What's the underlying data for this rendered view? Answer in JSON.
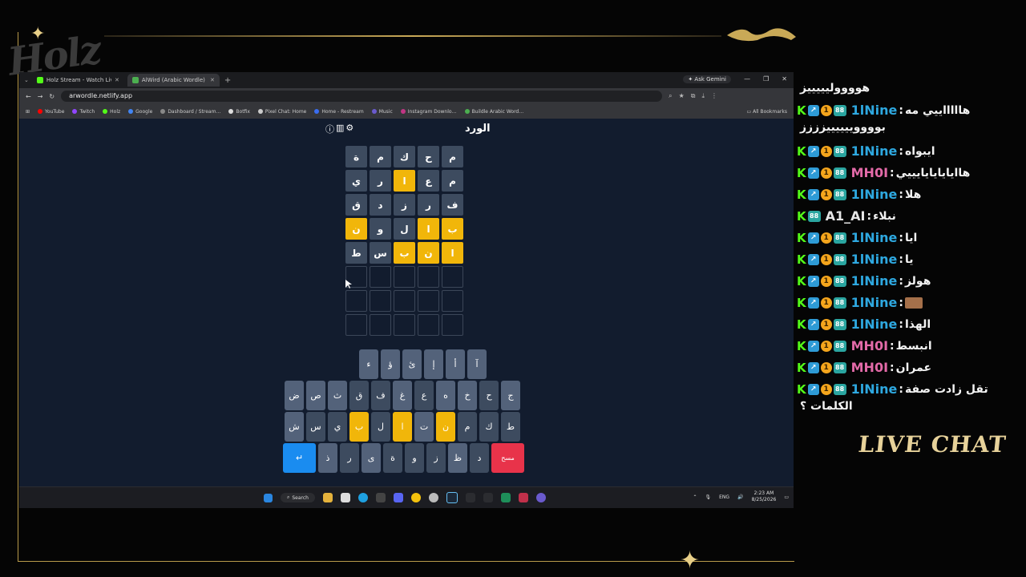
{
  "overlay": {
    "brand": "Holz",
    "live_chat_label": "LIVE CHAT"
  },
  "browser": {
    "tabs": [
      {
        "label": "Holz Stream - Watch Live on Ki…",
        "active": false
      },
      {
        "label": "AlWird (Arabic Wordle) - الورد",
        "active": true
      }
    ],
    "ask_gemini": "Ask Gemini",
    "url": "arwordle.netlify.app",
    "bookmarks": [
      "YouTube",
      "Twitch",
      "Holz",
      "Google",
      "Dashboard / Stream…",
      "Botfix",
      "Pixel Chat: Home",
      "Home - Restream",
      "Music",
      "Instagram Downlo…",
      "Buildle Arabic Word…"
    ],
    "all_bookmarks": "All Bookmarks"
  },
  "game": {
    "title": "الورد",
    "grid": [
      [
        {
          "l": "م",
          "s": "absent"
        },
        {
          "l": "ح",
          "s": "absent"
        },
        {
          "l": "ك",
          "s": "absent"
        },
        {
          "l": "م",
          "s": "absent"
        },
        {
          "l": "ة",
          "s": "absent"
        }
      ],
      [
        {
          "l": "م",
          "s": "absent"
        },
        {
          "l": "ع",
          "s": "absent"
        },
        {
          "l": "ا",
          "s": "present"
        },
        {
          "l": "ر",
          "s": "absent"
        },
        {
          "l": "ي",
          "s": "absent"
        }
      ],
      [
        {
          "l": "ف",
          "s": "absent"
        },
        {
          "l": "ر",
          "s": "absent"
        },
        {
          "l": "ز",
          "s": "absent"
        },
        {
          "l": "د",
          "s": "absent"
        },
        {
          "l": "ق",
          "s": "absent"
        }
      ],
      [
        {
          "l": "ب",
          "s": "present"
        },
        {
          "l": "ا",
          "s": "present"
        },
        {
          "l": "ل",
          "s": "absent"
        },
        {
          "l": "و",
          "s": "absent"
        },
        {
          "l": "ن",
          "s": "present"
        }
      ],
      [
        {
          "l": "ا",
          "s": "present"
        },
        {
          "l": "ن",
          "s": "present"
        },
        {
          "l": "ب",
          "s": "present"
        },
        {
          "l": "س",
          "s": "absent"
        },
        {
          "l": "ط",
          "s": "absent"
        }
      ],
      [
        {
          "l": "",
          "s": "empty"
        },
        {
          "l": "",
          "s": "empty"
        },
        {
          "l": "",
          "s": "empty"
        },
        {
          "l": "",
          "s": "empty"
        },
        {
          "l": "",
          "s": "empty"
        }
      ],
      [
        {
          "l": "",
          "s": "empty"
        },
        {
          "l": "",
          "s": "empty"
        },
        {
          "l": "",
          "s": "empty"
        },
        {
          "l": "",
          "s": "empty"
        },
        {
          "l": "",
          "s": "empty"
        }
      ],
      [
        {
          "l": "",
          "s": "empty"
        },
        {
          "l": "",
          "s": "empty"
        },
        {
          "l": "",
          "s": "empty"
        },
        {
          "l": "",
          "s": "empty"
        },
        {
          "l": "",
          "s": "empty"
        }
      ]
    ],
    "keyboard": [
      [
        {
          "k": "آ",
          "s": "light"
        },
        {
          "k": "أ",
          "s": "light"
        },
        {
          "k": "إ",
          "s": "light"
        },
        {
          "k": "ئ",
          "s": "light"
        },
        {
          "k": "ؤ",
          "s": "light"
        },
        {
          "k": "ء",
          "s": "light"
        }
      ],
      [
        {
          "k": "ج",
          "s": "light"
        },
        {
          "k": "ح",
          "s": "absent"
        },
        {
          "k": "خ",
          "s": "light"
        },
        {
          "k": "ه",
          "s": "light"
        },
        {
          "k": "ع",
          "s": "absent"
        },
        {
          "k": "غ",
          "s": "light"
        },
        {
          "k": "ف",
          "s": "absent"
        },
        {
          "k": "ق",
          "s": "absent"
        },
        {
          "k": "ث",
          "s": "light"
        },
        {
          "k": "ص",
          "s": "light"
        },
        {
          "k": "ض",
          "s": "light"
        }
      ],
      [
        {
          "k": "ط",
          "s": "absent"
        },
        {
          "k": "ك",
          "s": "absent"
        },
        {
          "k": "م",
          "s": "absent"
        },
        {
          "k": "ن",
          "s": "present"
        },
        {
          "k": "ت",
          "s": "light"
        },
        {
          "k": "ا",
          "s": "present"
        },
        {
          "k": "ل",
          "s": "absent"
        },
        {
          "k": "ب",
          "s": "present"
        },
        {
          "k": "ي",
          "s": "absent"
        },
        {
          "k": "س",
          "s": "absent"
        },
        {
          "k": "ش",
          "s": "light"
        }
      ],
      [
        {
          "k": "مسح",
          "s": "del"
        },
        {
          "k": "د",
          "s": "absent"
        },
        {
          "k": "ظ",
          "s": "light"
        },
        {
          "k": "ز",
          "s": "absent"
        },
        {
          "k": "و",
          "s": "absent"
        },
        {
          "k": "ة",
          "s": "absent"
        },
        {
          "k": "ى",
          "s": "light"
        },
        {
          "k": "ر",
          "s": "absent"
        },
        {
          "k": "ذ",
          "s": "light"
        },
        {
          "k": "↵",
          "s": "enter"
        }
      ]
    ]
  },
  "taskbar": {
    "search": "Search",
    "lang": "ENG",
    "time": "2:23 AM",
    "date": "8/25/2026"
  },
  "chat": {
    "messages": [
      {
        "user": "1lNine",
        "color": "#2ea8e0",
        "text": "هووووليييييز",
        "badges": 3,
        "wrap_only": true
      },
      {
        "user": "1lNine",
        "color": "#2ea8e0",
        "text": "هاااااييي مه",
        "cont": "بووووييييييزززز",
        "badges": 3
      },
      {
        "user": "1lNine",
        "color": "#2ea8e0",
        "text": "ايبواه",
        "badges": 3
      },
      {
        "user": "MH0I",
        "color": "#e36aa8",
        "text": "هاايايايايايييي",
        "badges": 3
      },
      {
        "user": "1lNine",
        "color": "#2ea8e0",
        "text": "هلا",
        "badges": 3
      },
      {
        "user": "A1_AI",
        "color": "#e6e6e6",
        "text": "نبلاء",
        "badges": 1
      },
      {
        "user": "1lNine",
        "color": "#2ea8e0",
        "text": "ايا",
        "badges": 3
      },
      {
        "user": "1lNine",
        "color": "#2ea8e0",
        "text": "يا",
        "badges": 3
      },
      {
        "user": "1lNine",
        "color": "#2ea8e0",
        "text": "هولز",
        "badges": 3
      },
      {
        "user": "1lNine",
        "color": "#2ea8e0",
        "text": "",
        "emote": true,
        "badges": 3
      },
      {
        "user": "1lNine",
        "color": "#2ea8e0",
        "text": "الهذا",
        "badges": 3
      },
      {
        "user": "MH0I",
        "color": "#e36aa8",
        "text": "انبسط",
        "badges": 3
      },
      {
        "user": "MH0I",
        "color": "#e36aa8",
        "text": "عمران",
        "badges": 3
      },
      {
        "user": "1lNine",
        "color": "#2ea8e0",
        "text": "تقل زادت صفة",
        "cont": "الكلمات ؟",
        "badges": 3
      }
    ]
  }
}
